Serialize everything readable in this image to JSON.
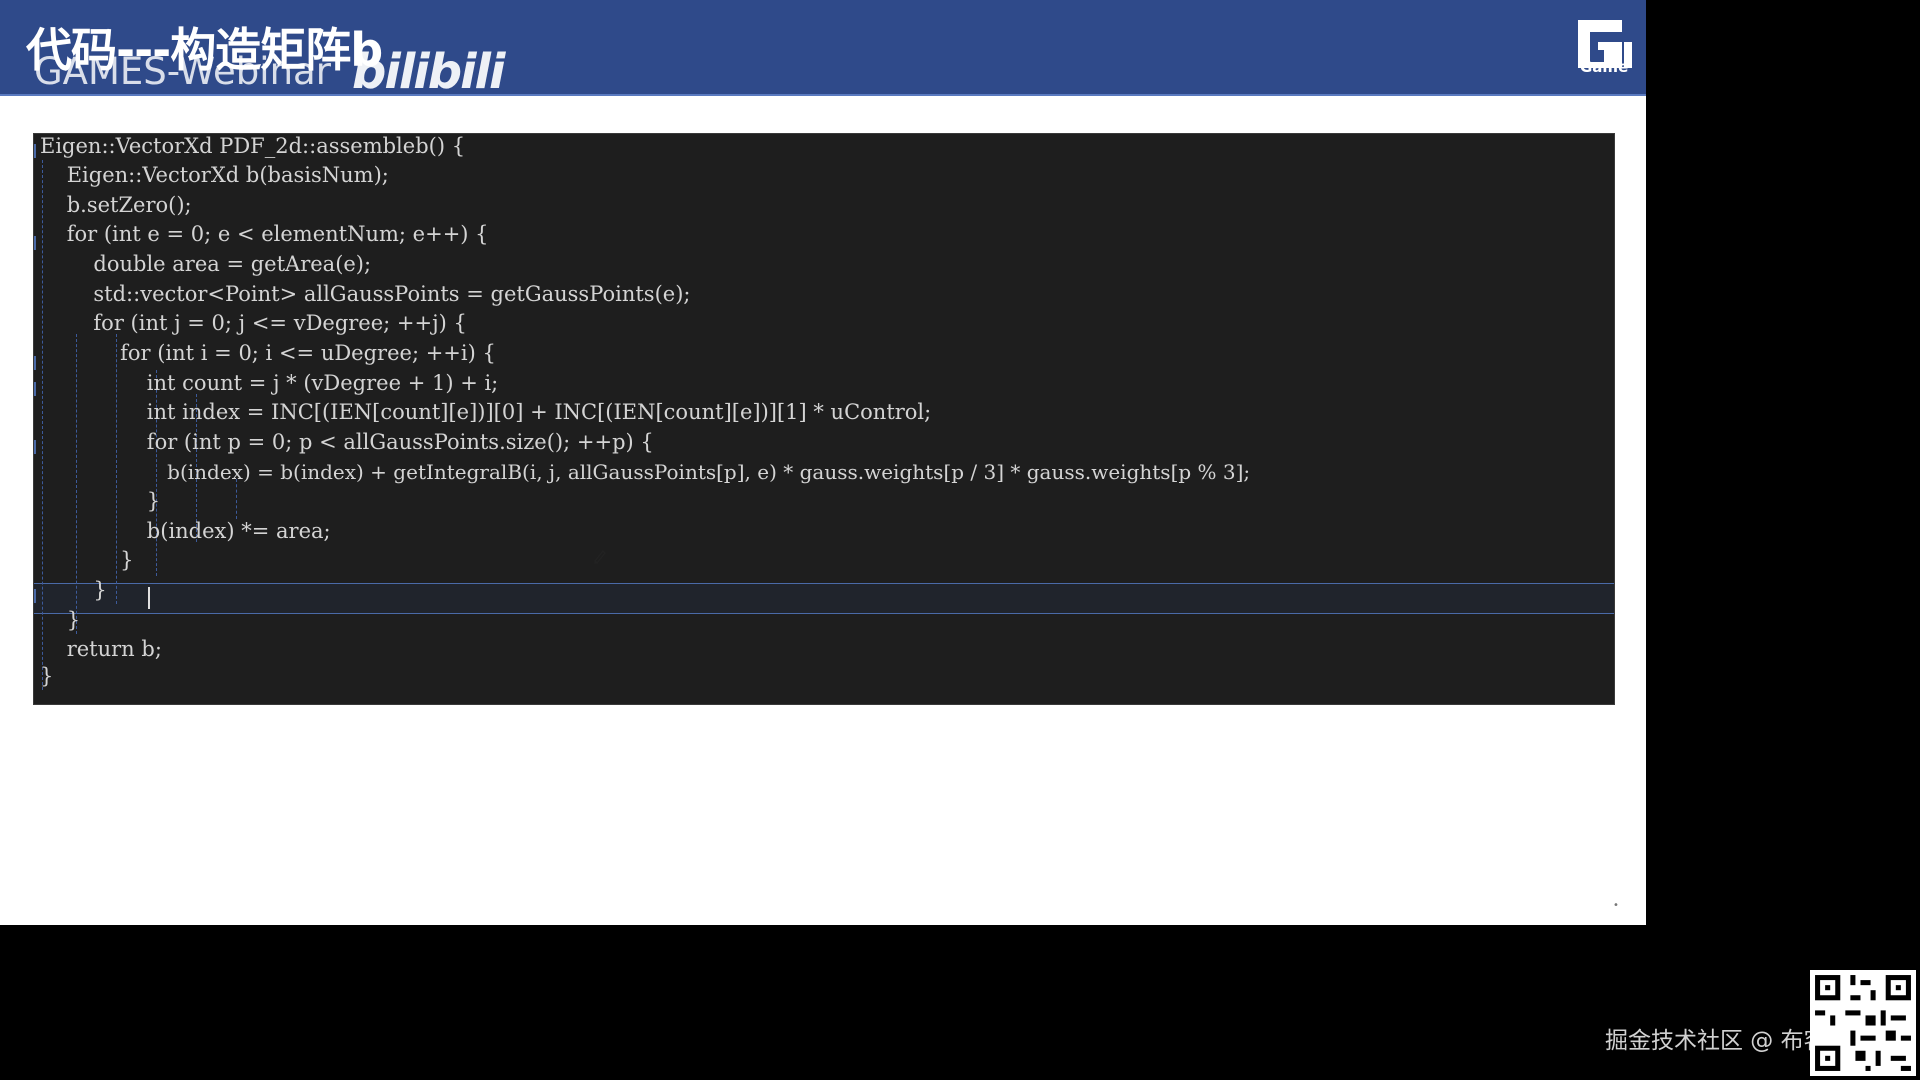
{
  "slide": {
    "title": "代码---构造矩阵b",
    "subtitle": "GAMES-Webinar",
    "platform_mark": "bilibili",
    "logo_text": "Game"
  },
  "code": {
    "lines": [
      "Eigen::VectorXd PDF_2d::assembleb() {",
      "    Eigen::VectorXd b(basisNum);",
      "    b.setZero();",
      "    for (int e = 0; e < elementNum; e++) {",
      "        double area = getArea(e);",
      "        std::vector<Point> allGaussPoints = getGaussPoints(e);",
      "        for (int j = 0; j <= vDegree; ++j) {",
      "            for (int i = 0; i <= uDegree; ++i) {",
      "                int count = j * (vDegree + 1) + i;",
      "                int index = INC[(IEN[count][e])][0] + INC[(IEN[count][e])][1] * uControl;",
      "                for (int p = 0; p < allGaussPoints.size(); ++p) {",
      "                    b(index) = b(index) + getIntegralB(i, j, allGaussPoints[p], e) * gauss.weights[p / 3] * gauss.weights[p % 3];",
      "                }",
      "                b(index) *= area;",
      "            }",
      "        }",
      "    }",
      "    return b;",
      "}"
    ]
  },
  "footer": {
    "watermark": "掘金技术社区 @ 布客飞龙"
  },
  "colors": {
    "header_bg": "#2f4a8a",
    "editor_bg": "#1e1e1e",
    "code_text": "#d4d4d4",
    "indent_guide": "#3c5a9a"
  }
}
